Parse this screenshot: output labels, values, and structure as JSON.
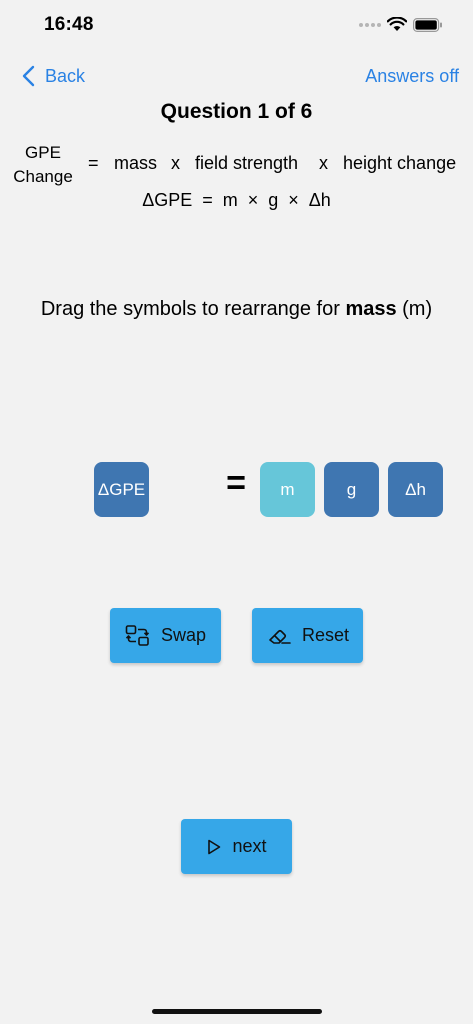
{
  "status": {
    "time": "16:48"
  },
  "nav": {
    "back_label": "Back",
    "answers_label": "Answers off"
  },
  "question": {
    "title": "Question 1 of 6"
  },
  "equation": {
    "gpe_line1": "GPE",
    "gpe_line2": "Change",
    "equals": "=",
    "mass": "mass",
    "times1": "x",
    "field_strength": "field strength",
    "times2": "x",
    "height_change": "height change",
    "symbolic": "ΔGPE  =  m  ×  g  ×  Δh"
  },
  "instruction": {
    "prefix": "Drag the symbols to rearrange for ",
    "target": "mass",
    "suffix": " (m)"
  },
  "tiles": {
    "left": "ΔGPE",
    "equals": "=",
    "right": [
      "m",
      "g",
      "Δh"
    ]
  },
  "buttons": {
    "swap": "Swap",
    "reset": "Reset",
    "next": "next"
  },
  "colors": {
    "accent": "#2a82e4",
    "button": "#36a7e8",
    "tile_dark": "#3f76b1",
    "tile_highlight": "#66c6d9",
    "background": "#f2f2f2"
  },
  "icons": {
    "back": "chevron-left-icon",
    "swap": "swap-icon",
    "reset": "eraser-icon",
    "next": "play-icon"
  }
}
